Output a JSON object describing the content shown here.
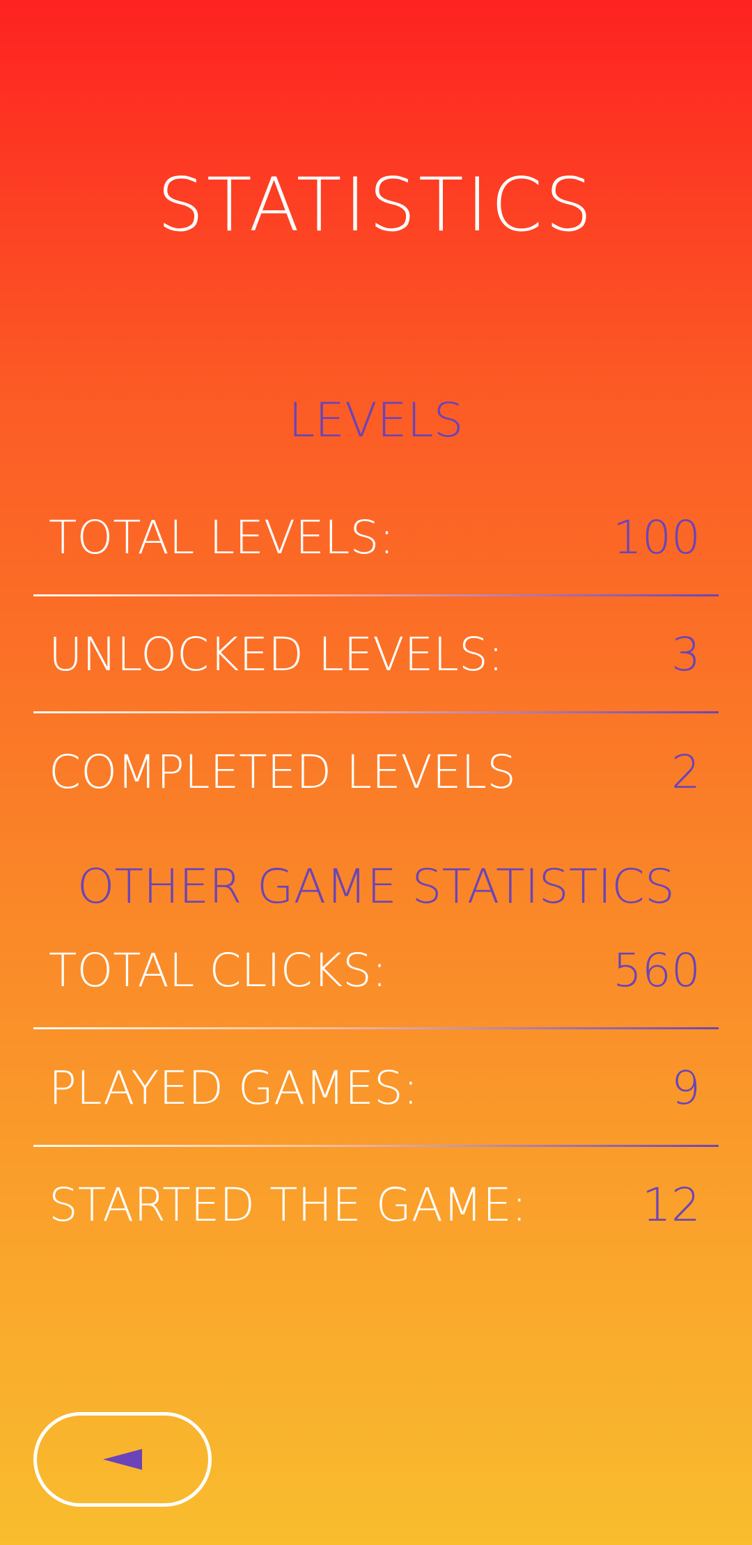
{
  "screen": {
    "title": "STATISTICS"
  },
  "levels_section": {
    "heading": "LEVELS",
    "rows": [
      {
        "label": "TOTAL LEVELS:",
        "value": "100"
      },
      {
        "label": "UNLOCKED LEVELS:",
        "value": "3"
      },
      {
        "label": "COMPLETED LEVELS",
        "value": "2"
      }
    ]
  },
  "other_section": {
    "heading": "OTHER GAME STATISTICS",
    "rows": [
      {
        "label": "TOTAL CLICKS:",
        "value": "560"
      },
      {
        "label": "PLAYED GAMES:",
        "value": "9"
      },
      {
        "label": "STARTED THE GAME:",
        "value": "12"
      }
    ]
  },
  "back_button": {
    "icon": "back-arrow-icon"
  },
  "colors": {
    "gradient_top": "#FE2221",
    "gradient_bottom": "#F9BD2E",
    "accent": "#6A44B8",
    "text": "#FFFFFF"
  }
}
